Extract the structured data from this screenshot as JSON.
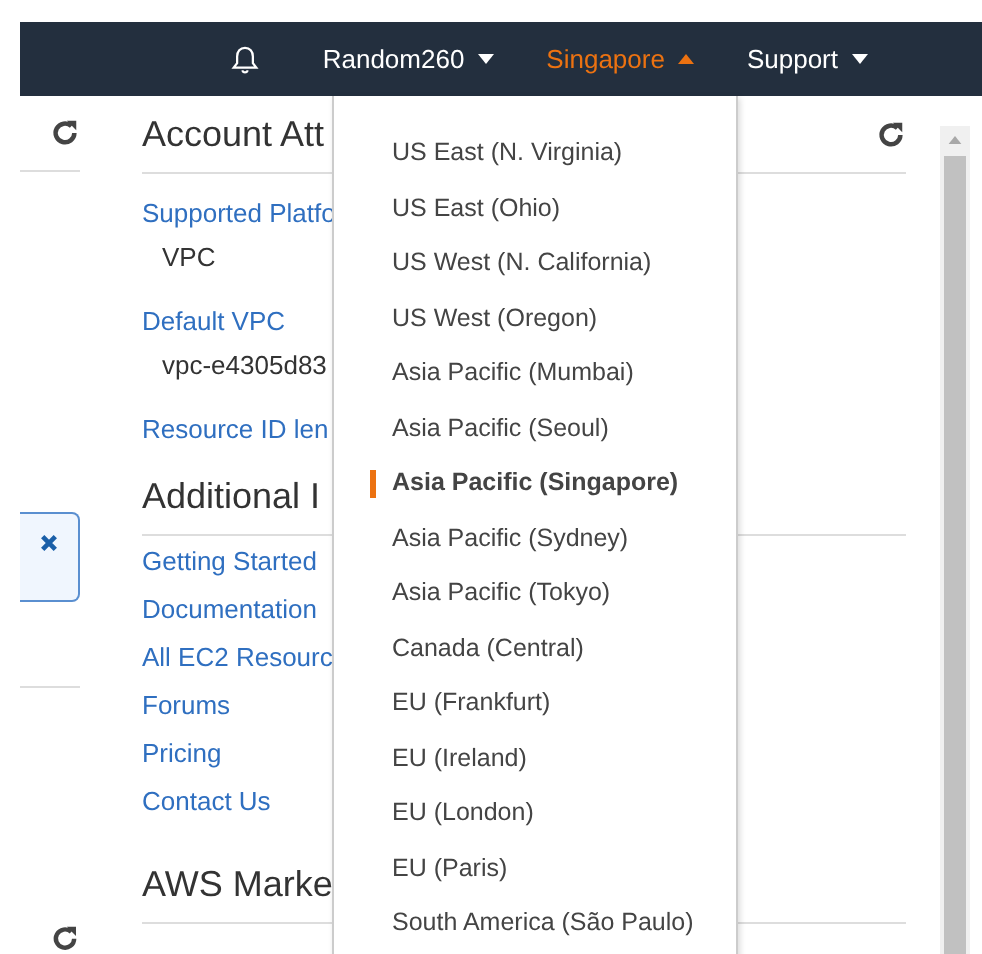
{
  "header": {
    "nav": [
      {
        "label": "Random260",
        "expanded": false
      },
      {
        "label": "Singapore",
        "expanded": true
      },
      {
        "label": "Support",
        "expanded": false
      }
    ]
  },
  "sections": [
    {
      "title": "Account Att",
      "items": [
        {
          "kind": "link",
          "text": "Supported Platfo"
        },
        {
          "kind": "value",
          "text": "VPC"
        },
        {
          "kind": "link",
          "text": "Default VPC"
        },
        {
          "kind": "value",
          "text": "vpc-e4305d83"
        },
        {
          "kind": "link",
          "text": "Resource ID len"
        }
      ]
    },
    {
      "title": "Additional I",
      "items": [
        {
          "kind": "link",
          "text": "Getting Started"
        },
        {
          "kind": "link",
          "text": "Documentation"
        },
        {
          "kind": "link",
          "text": "All EC2 Resourc"
        },
        {
          "kind": "link",
          "text": "Forums"
        },
        {
          "kind": "link",
          "text": "Pricing"
        },
        {
          "kind": "link",
          "text": "Contact Us"
        }
      ]
    },
    {
      "title": "AWS Marke"
    }
  ],
  "region_menu": [
    {
      "label": "US East (N. Virginia)",
      "selected": false
    },
    {
      "label": "US East (Ohio)",
      "selected": false
    },
    {
      "label": "US West (N. California)",
      "selected": false
    },
    {
      "label": "US West (Oregon)",
      "selected": false
    },
    {
      "label": "Asia Pacific (Mumbai)",
      "selected": false
    },
    {
      "label": "Asia Pacific (Seoul)",
      "selected": false
    },
    {
      "label": "Asia Pacific (Singapore)",
      "selected": true
    },
    {
      "label": "Asia Pacific (Sydney)",
      "selected": false
    },
    {
      "label": "Asia Pacific (Tokyo)",
      "selected": false
    },
    {
      "label": "Canada (Central)",
      "selected": false
    },
    {
      "label": "EU (Frankfurt)",
      "selected": false
    },
    {
      "label": "EU (Ireland)",
      "selected": false
    },
    {
      "label": "EU (London)",
      "selected": false
    },
    {
      "label": "EU (Paris)",
      "selected": false
    },
    {
      "label": "South America (São Paulo)",
      "selected": false
    }
  ]
}
